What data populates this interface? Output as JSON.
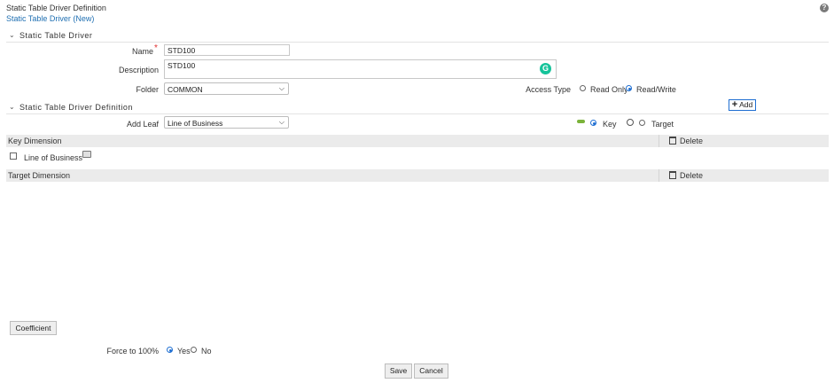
{
  "header": {
    "title": "Static Table Driver Definition",
    "breadcrumb": "Static Table Driver (New)"
  },
  "section1": {
    "title": "Static Table Driver"
  },
  "form": {
    "name_label": "Name",
    "required_mark": "*",
    "name_value": "STD100",
    "description_label": "Description",
    "description_value": "STD100",
    "folder_label": "Folder",
    "folder_value": "COMMON",
    "access_type_label": "Access Type",
    "access_options": [
      "Read Only",
      "Read/Write"
    ],
    "access_selected": "Read/Write"
  },
  "section2": {
    "title": "Static Table Driver Definition"
  },
  "add_button": "Add",
  "add_leaf": {
    "label": "Add Leaf",
    "value": "Line of Business",
    "options": [
      "Key",
      "Target"
    ],
    "selected": "Key"
  },
  "key_dimension": {
    "header": "Key Dimension",
    "delete_label": "Delete",
    "items": [
      {
        "label": "Line of Business"
      }
    ]
  },
  "target_dimension": {
    "header": "Target Dimension",
    "delete_label": "Delete"
  },
  "coefficient_button": "Coefficient",
  "force": {
    "label": "Force to 100%",
    "options": [
      "Yes",
      "No"
    ],
    "selected": "Yes"
  },
  "actions": {
    "save": "Save",
    "cancel": "Cancel"
  },
  "colors": {
    "link": "#1f6fb2",
    "accent": "#1f6fd2",
    "grammarly": "#15c39a",
    "band": "#ebebeb"
  }
}
